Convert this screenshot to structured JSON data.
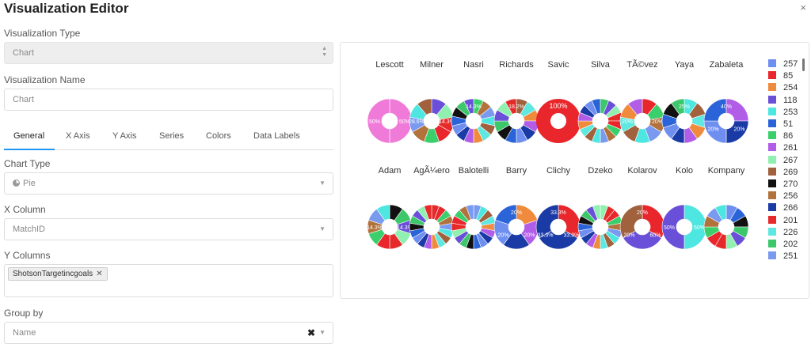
{
  "header": {
    "title": "Visualization Editor",
    "close_icon": "×"
  },
  "form": {
    "viz_type_label": "Visualization Type",
    "viz_type_value": "Chart",
    "viz_name_label": "Visualization Name",
    "viz_name_placeholder": "Chart",
    "tabs": [
      "General",
      "X Axis",
      "Y Axis",
      "Series",
      "Colors",
      "Data Labels"
    ],
    "active_tab": "General",
    "chart_type_label": "Chart Type",
    "chart_type_value": "Pie",
    "x_column_label": "X Column",
    "x_column_value": "MatchID",
    "y_columns_label": "Y Columns",
    "y_columns_tags": [
      "ShotsonTargetincgoals"
    ],
    "group_by_label": "Group by",
    "group_by_value": "Name"
  },
  "chart_data": {
    "type": "pie",
    "hole": true,
    "pies": [
      {
        "name": "Lescott",
        "labels": [
          "50%",
          "50%"
        ]
      },
      {
        "name": "Milner",
        "labels": [
          "28.6%",
          "14.3%"
        ]
      },
      {
        "name": "Nasri",
        "labels": [
          "14.3%"
        ]
      },
      {
        "name": "Richards",
        "labels": [
          "18.2%"
        ]
      },
      {
        "name": "Savic",
        "labels": [
          "100%"
        ]
      },
      {
        "name": "Silva",
        "labels": []
      },
      {
        "name": "TÃ©vez",
        "labels": [
          "20%",
          "20%"
        ]
      },
      {
        "name": "Yaya",
        "labels": [
          "25%"
        ]
      },
      {
        "name": "Zabaleta",
        "labels": [
          "20%",
          "40%",
          "20%"
        ]
      },
      {
        "name": "Adam",
        "labels": [
          "14.3%",
          "14.3%"
        ]
      },
      {
        "name": "AgÃ¼ero",
        "labels": []
      },
      {
        "name": "Balotelli",
        "labels": []
      },
      {
        "name": "Barry",
        "labels": [
          "20%",
          "20%",
          "20%"
        ]
      },
      {
        "name": "Clichy",
        "labels": [
          "33.3%",
          "33.3%",
          "33.3%"
        ]
      },
      {
        "name": "Dzeko",
        "labels": []
      },
      {
        "name": "Kolarov",
        "labels": [
          "20%",
          "20%",
          "60%"
        ]
      },
      {
        "name": "Kolo",
        "labels": [
          "50%",
          "50%"
        ]
      },
      {
        "name": "Kompany",
        "labels": []
      }
    ],
    "legend": [
      {
        "label": "257",
        "color": "#6e8ff0"
      },
      {
        "label": "85",
        "color": "#e8262b"
      },
      {
        "label": "254",
        "color": "#f08a3c"
      },
      {
        "label": "118",
        "color": "#6a4fd8"
      },
      {
        "label": "253",
        "color": "#4ee6e0"
      },
      {
        "label": "51",
        "color": "#2a64d8"
      },
      {
        "label": "86",
        "color": "#3bcf6b"
      },
      {
        "label": "261",
        "color": "#b15de8"
      },
      {
        "label": "267",
        "color": "#8ff0b0"
      },
      {
        "label": "269",
        "color": "#a0613c"
      },
      {
        "label": "270",
        "color": "#111111"
      },
      {
        "label": "256",
        "color": "#b2723c"
      },
      {
        "label": "266",
        "color": "#1a3aa6"
      },
      {
        "label": "201",
        "color": "#e62a2a"
      },
      {
        "label": "226",
        "color": "#5ee8e0"
      },
      {
        "label": "202",
        "color": "#3cc76a"
      },
      {
        "label": "251",
        "color": "#7a9af0"
      }
    ]
  }
}
